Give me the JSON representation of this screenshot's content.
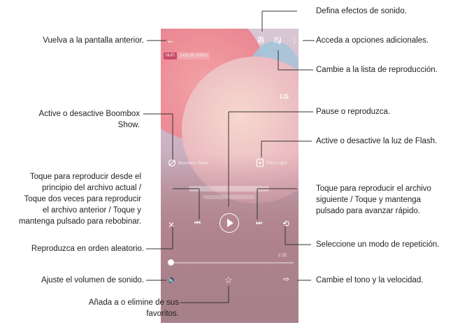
{
  "screen": {
    "hifi_badge": "Hi-Fi",
    "hifi_info": "24bit 96 000Hz",
    "lg_logo": "LG",
    "boombox_label": "Boombox Show",
    "flash_label": "Flash Light",
    "time_total": "2:25"
  },
  "callouts": {
    "back": "Vuelva a la pantalla anterior.",
    "effects": "Defina efectos de sonido.",
    "more": "Acceda a opciones adicionales.",
    "playlist": "Cambie a la lista de reproducción.",
    "boombox_1": "Active o desactive Boombox",
    "boombox_2": "Show.",
    "pause": "Pause o reproduzca.",
    "flash": "Active o desactive la luz de Flash.",
    "prev_1": "Toque para reproducir desde el",
    "prev_2": "principio del archivo actual /",
    "prev_3": "Toque dos veces para reproducir",
    "prev_4": "el archivo anterior / Toque y",
    "prev_5": "mantenga pulsado para rebobinar.",
    "next_1": "Toque para reproducir el archivo",
    "next_2": "siguiente / Toque y mantenga",
    "next_3": "pulsado para avanzar rápido.",
    "shuffle": "Reproduzca en orden aleatorio.",
    "repeat": "Seleccione un modo de repetición.",
    "volume": "Ajuste el volumen de sonido.",
    "pitch": "Cambie el tono y la velocidad.",
    "fav_1": "Añada a o elimine de sus",
    "fav_2": "favoritos."
  },
  "icons": [
    "back-arrow-icon",
    "equalizer-icon",
    "playlist-icon",
    "more-vert-icon",
    "boombox-icon",
    "flash-icon",
    "previous-icon",
    "play-icon",
    "next-icon",
    "shuffle-icon",
    "repeat-icon",
    "volume-icon",
    "favorite-star-icon",
    "pitch-speed-icon"
  ]
}
